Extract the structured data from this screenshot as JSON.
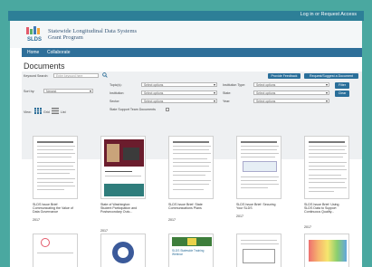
{
  "topbar": {
    "login": "Log in or Request Access"
  },
  "header": {
    "title_line1": "Statewide Longitudinal Data Systems",
    "title_line2": "Grant Program",
    "logo_text": "SLDS"
  },
  "nav": {
    "items": [
      "Home",
      "Collaborate"
    ]
  },
  "page": {
    "title": "Documents"
  },
  "filters": {
    "keyword_label": "Keyword Search:",
    "keyword_placeholder": "Enter keyword here",
    "sort_label": "Sort by:",
    "sort_value": "Newest",
    "topics_label": "Topic(s):",
    "audience_label": "Institution:",
    "sector_label": "Sector:",
    "inst_type_label": "Institution Type:",
    "state_label": "State:",
    "year_label": "Year:",
    "select_placeholder": "Select options",
    "support_team_label": "State Support Team Documents",
    "view_label": "View:",
    "grid_label": "Grid",
    "list_label": "List",
    "provide_feedback": "Provide Feedback",
    "request_doc": "Request/Suggest a Document",
    "filter_btn": "Filter",
    "clear_btn": "Clear"
  },
  "docs": [
    {
      "caption": "SLDS Issue Brief: Communicating the Value of Data Governance",
      "year": "2017"
    },
    {
      "caption": "State of Washington: Student Participation and Postsecondary Outc...",
      "year": "2017"
    },
    {
      "caption": "SLDS Issue Brief: State Communications Plans",
      "year": "2017"
    },
    {
      "caption": "SLDS Issue Brief: Securing Your SLDS",
      "year": "2017"
    },
    {
      "caption": "SLDS Issue Brief: Using SLDS Data to Support Continuous Quality...",
      "year": "2017"
    }
  ],
  "second_row_titles": [
    "",
    "",
    "SLDS Statewide Training Webinar",
    "",
    ""
  ]
}
